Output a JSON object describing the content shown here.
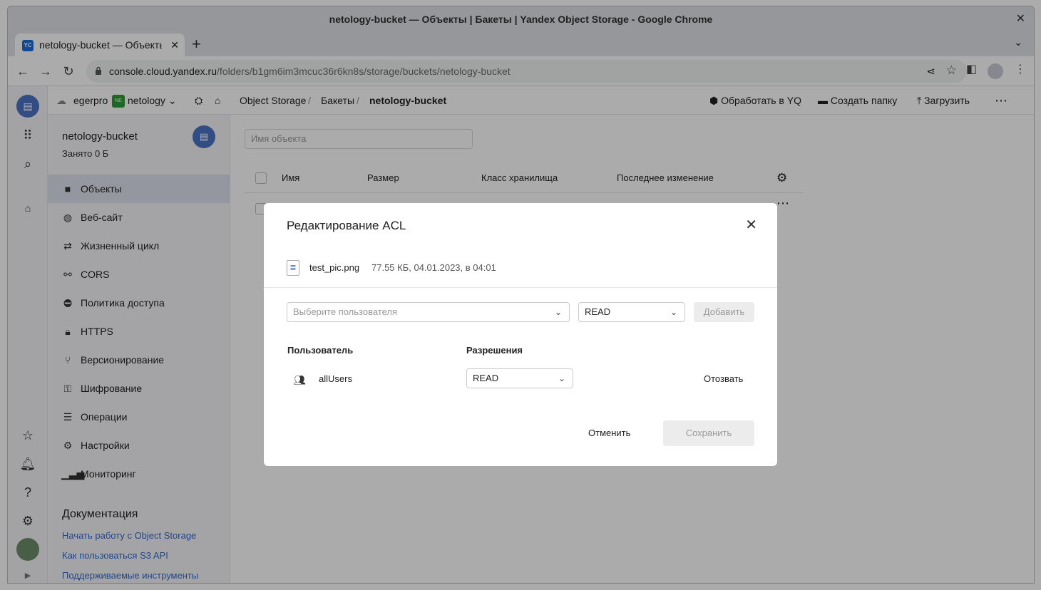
{
  "browser": {
    "window_title": "netology-bucket — Объекты | Бакеты | Yandex Object Storage - Google Chrome",
    "tab_title": "netology-bucket — Объекты | Бакеты | Yandex Object Storage",
    "favicon_text": "YC",
    "url_host": "console.cloud.yandex.ru",
    "url_path": "/folders/b1gm6im3mcuc36r6kn8s/storage/buckets/netology-bucket"
  },
  "topbar": {
    "cloud": "egerpro",
    "folder_badge": "NE",
    "folder": "netology",
    "breadcrumbs": [
      "Object Storage",
      "Бакеты",
      "netology-bucket"
    ],
    "actions": {
      "yq": "Обработать в YQ",
      "create_folder": "Создать папку",
      "upload": "Загрузить"
    }
  },
  "sidebar": {
    "bucket_name": "netology-bucket",
    "bucket_size": "Занято 0 Б",
    "items": [
      {
        "label": "Объекты",
        "icon": "folder-icon",
        "active": true
      },
      {
        "label": "Веб-сайт",
        "icon": "globe-icon"
      },
      {
        "label": "Жизненный цикл",
        "icon": "cycle-icon"
      },
      {
        "label": "CORS",
        "icon": "cors-icon"
      },
      {
        "label": "Политика доступа",
        "icon": "no-entry-icon"
      },
      {
        "label": "HTTPS",
        "icon": "lock-icon"
      },
      {
        "label": "Версионирование",
        "icon": "branch-icon"
      },
      {
        "label": "Шифрование",
        "icon": "key-icon"
      },
      {
        "label": "Операции",
        "icon": "list-icon"
      },
      {
        "label": "Настройки",
        "icon": "gear-icon"
      },
      {
        "label": "Мониторинг",
        "icon": "chart-icon"
      }
    ],
    "docs_title": "Документация",
    "docs_links": [
      "Начать работу с Object Storage",
      "Как пользоваться S3 API",
      "Поддерживаемые инструменты"
    ]
  },
  "main": {
    "search_placeholder": "Имя объекта",
    "columns": [
      "Имя",
      "Размер",
      "Класс хранилища",
      "Последнее изменение"
    ]
  },
  "modal": {
    "title": "Редактирование ACL",
    "file_name": "test_pic.png",
    "file_meta": "77.55 КБ, 04.01.2023, в 04:01",
    "user_select_placeholder": "Выберите пользователя",
    "permission_select_value": "READ",
    "add_button": "Добавить",
    "col_user": "Пользователь",
    "col_permissions": "Разрешения",
    "rows": [
      {
        "user": "allUsers",
        "permission": "READ",
        "revoke": "Отозвать"
      }
    ],
    "cancel_button": "Отменить",
    "save_button": "Сохранить"
  }
}
